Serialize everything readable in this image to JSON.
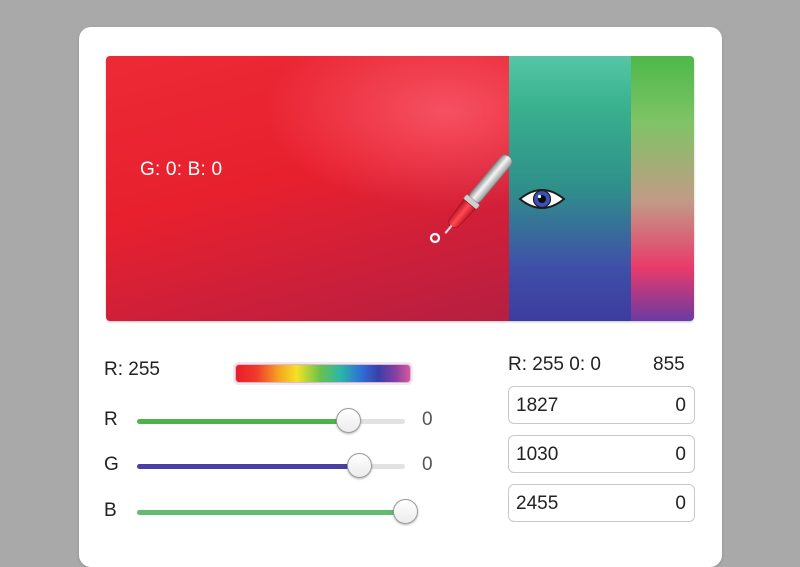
{
  "canvas": {
    "overlay_label": "G: 0: B: 0"
  },
  "readouts": {
    "left_label": "R: 255",
    "right_label": "R: 255 0: 0",
    "right_number": "855"
  },
  "sliders": [
    {
      "letter": "R",
      "value_label": "0",
      "fraction": 0.79,
      "color": "#4cb54a"
    },
    {
      "letter": "G",
      "value_label": "0",
      "fraction": 0.83,
      "color": "#4b3fa3"
    },
    {
      "letter": "B",
      "value_label": "",
      "fraction": 1.0,
      "color": "#63bb73"
    }
  ],
  "fields": [
    {
      "left": "1827",
      "right": "0"
    },
    {
      "left": "1030",
      "right": "0"
    },
    {
      "left": "2455",
      "right": "0"
    }
  ],
  "icons": {
    "dropper": "eyedropper-icon",
    "eye": "eye-icon"
  },
  "colors": {
    "primary_red": "#e8202e",
    "mid_teal": "#38b08e",
    "right_green": "#4db84a"
  }
}
